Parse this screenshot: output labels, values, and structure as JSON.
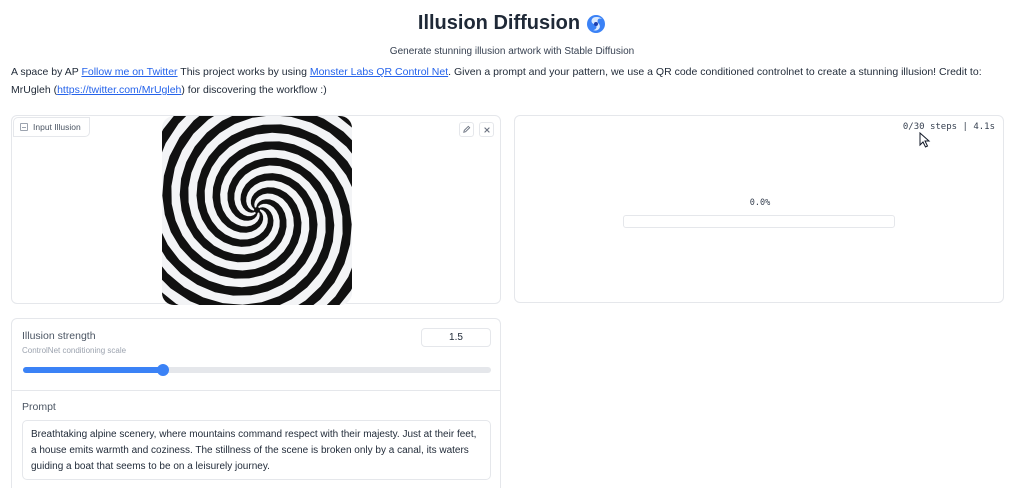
{
  "header": {
    "title": "Illusion Diffusion",
    "subtitle": "Generate stunning illusion artwork with Stable Diffusion"
  },
  "description": {
    "part1": "A space by AP ",
    "link_twitter": "Follow me on Twitter",
    "part2": " This project works by using ",
    "link_qr": "Monster Labs QR Control Net",
    "part3": ". Given a prompt and your pattern, we use a QR code conditioned controlnet to create a stunning illusion! Credit to: MrUgleh (",
    "link_mrugleh": "https://twitter.com/MrUgleh",
    "part4": ") for discovering the workflow :)"
  },
  "input_panel": {
    "label": "Input Illusion",
    "edit_icon": "pencil-icon",
    "close_icon": "close-icon"
  },
  "output_panel": {
    "steps_text": "0/30 steps | 4.1s",
    "percent_text": "0.0%",
    "progress": 0.0
  },
  "controls": {
    "strength_label": "Illusion strength",
    "strength_info": "ControlNet conditioning scale",
    "strength_value": "1.5",
    "slider_fraction": 0.3,
    "prompt_label": "Prompt",
    "prompt_value": "Breathtaking alpine scenery, where mountains command respect with their majesty. Just at their feet, a house emits warmth and coziness. The stillness of the scene is broken only by a canal, its waters guiding a boat that seems to be on a leisurely journey."
  },
  "colors": {
    "accent": "#3b82f6",
    "link": "#2563eb",
    "progress": "#f97316"
  }
}
